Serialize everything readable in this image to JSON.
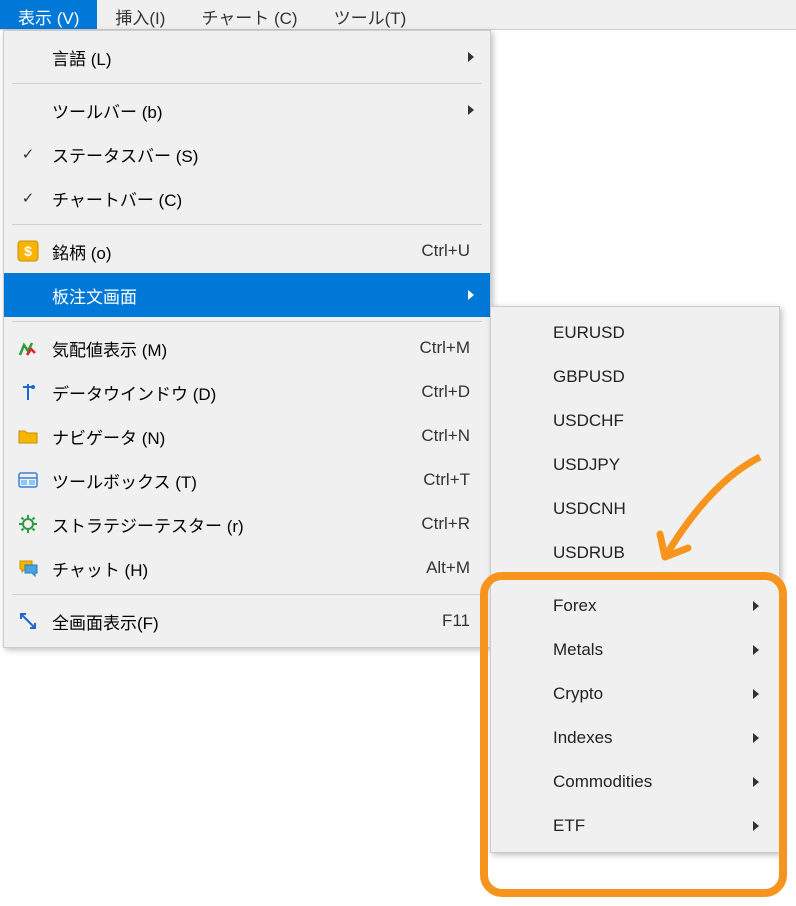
{
  "menubar": {
    "view": "表示 (V)",
    "insert": "挿入(I)",
    "chart": "チャート (C)",
    "tools": "ツール(T)"
  },
  "dropdown": {
    "language": "言語 (L)",
    "toolbar": "ツールバー (b)",
    "statusbar": "ステータスバー (S)",
    "chartbar": "チャートバー (C)",
    "symbols": "銘柄 (o)",
    "symbols_key": "Ctrl+U",
    "orderbook": "板注文画面",
    "quote": "気配値表示 (M)",
    "quote_key": "Ctrl+M",
    "datawindow": "データウインドウ (D)",
    "datawindow_key": "Ctrl+D",
    "navigator": "ナビゲータ (N)",
    "navigator_key": "Ctrl+N",
    "toolbox": "ツールボックス (T)",
    "toolbox_key": "Ctrl+T",
    "strategy": "ストラテジーテスター (r)",
    "strategy_key": "Ctrl+R",
    "chat": "チャット (H)",
    "chat_key": "Alt+M",
    "fullscreen": "全画面表示(F)",
    "fullscreen_key": "F11"
  },
  "submenu": {
    "eurusd": "EURUSD",
    "gbpusd": "GBPUSD",
    "usdchf": "USDCHF",
    "usdjpy": "USDJPY",
    "usdcnh": "USDCNH",
    "usdrub": "USDRUB",
    "forex": "Forex",
    "metals": "Metals",
    "crypto": "Crypto",
    "indexes": "Indexes",
    "commodities": "Commodities",
    "etf": "ETF"
  }
}
